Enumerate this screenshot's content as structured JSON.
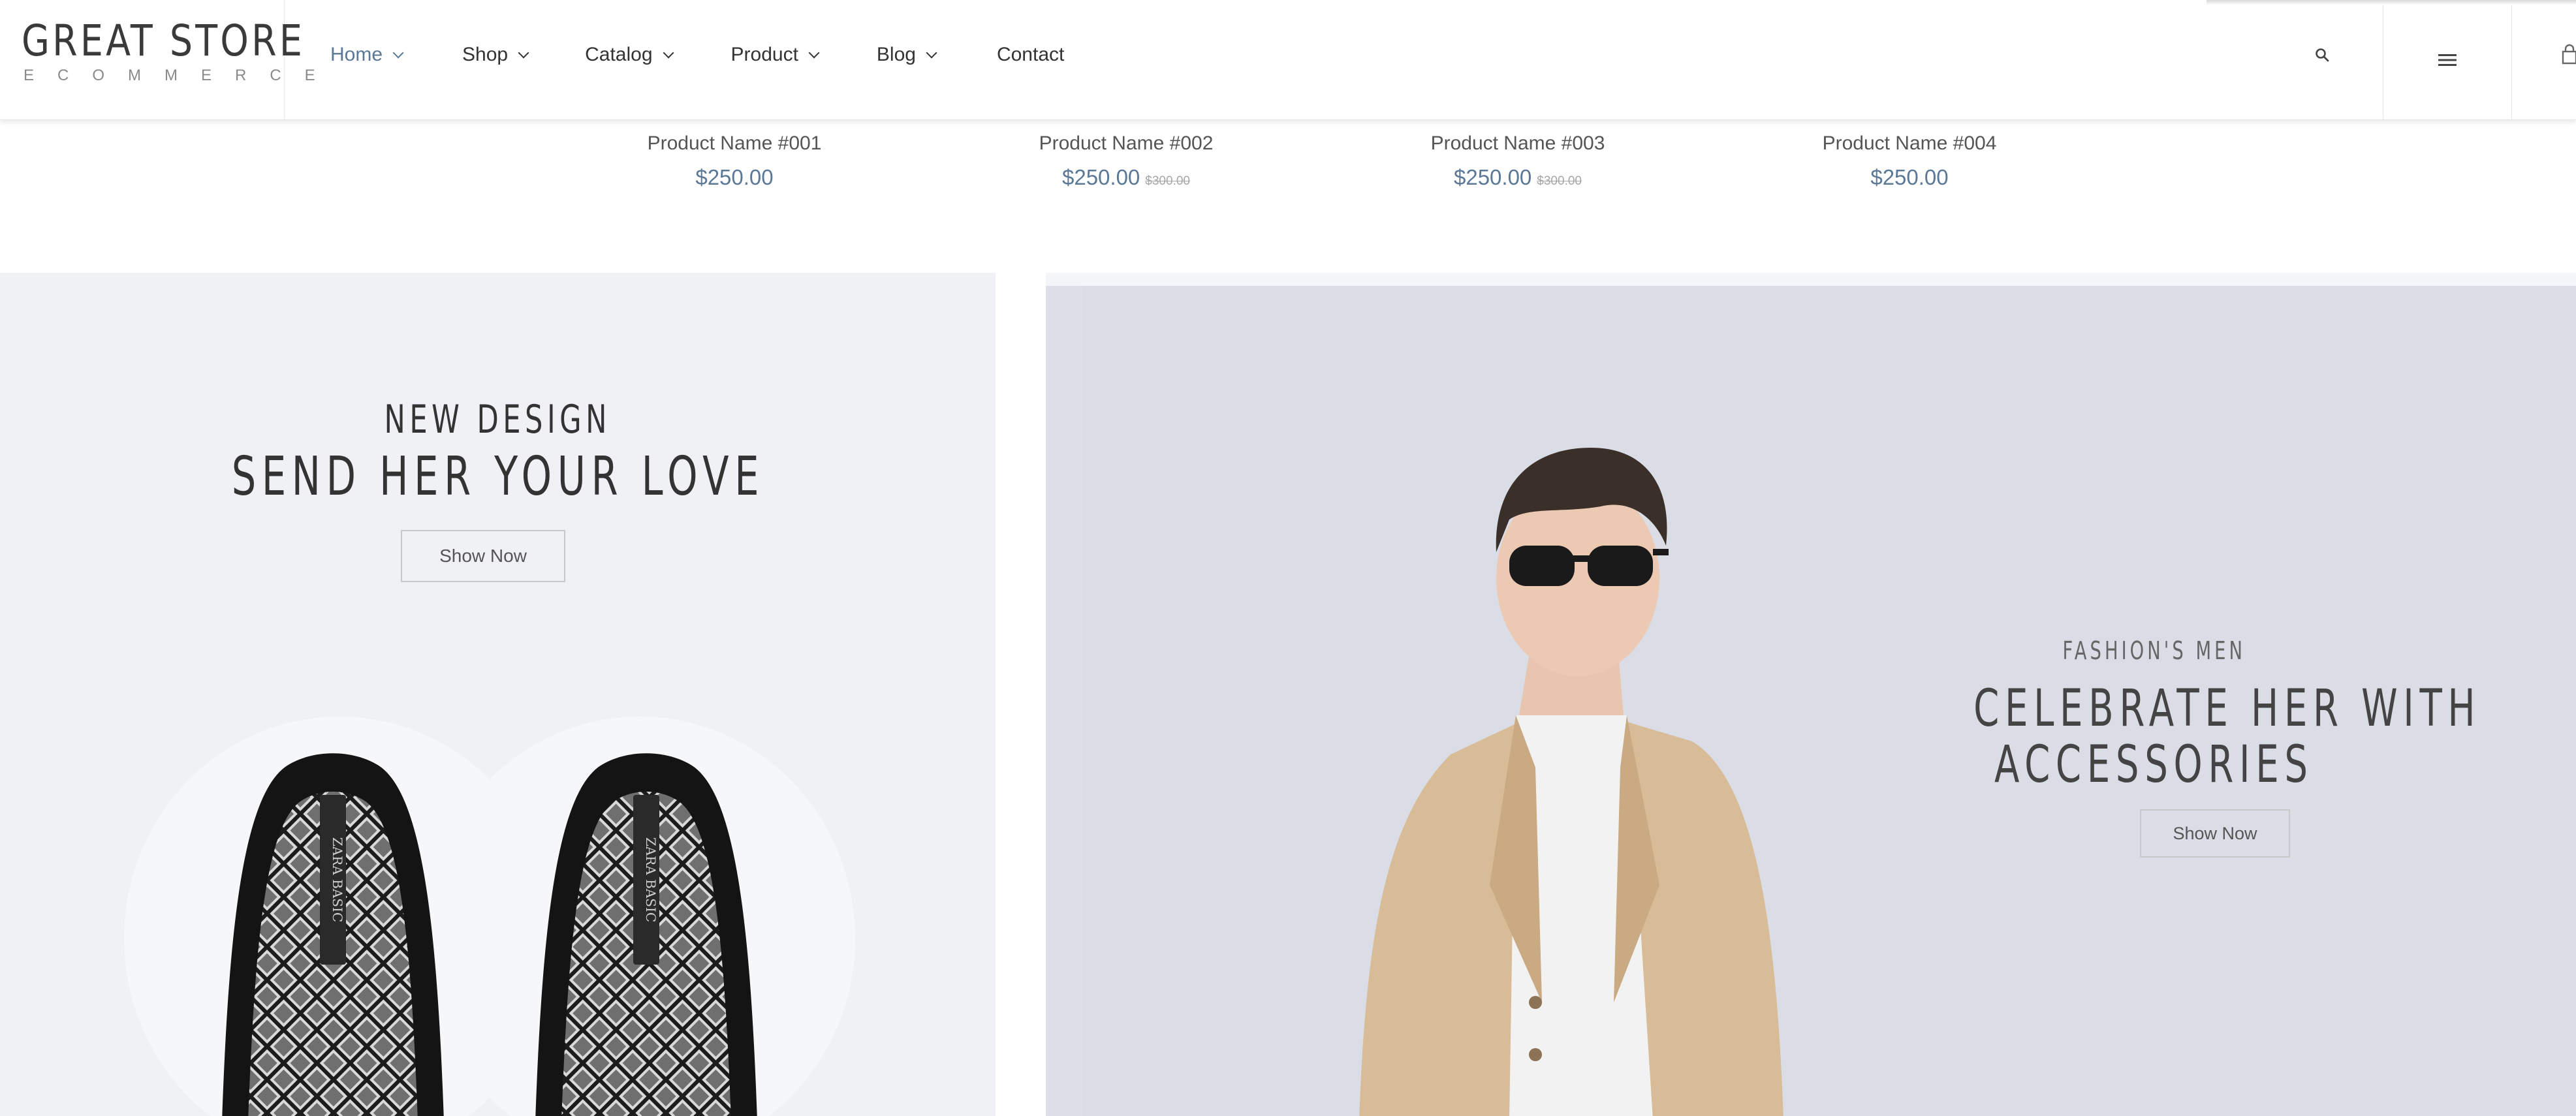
{
  "brand": {
    "title": "GREAT STORE",
    "subtitle": "ECOMMERCE"
  },
  "nav": {
    "items": [
      {
        "label": "Home",
        "dropdown": true,
        "active": true
      },
      {
        "label": "Shop",
        "dropdown": true
      },
      {
        "label": "Catalog",
        "dropdown": true
      },
      {
        "label": "Product",
        "dropdown": true
      },
      {
        "label": "Blog",
        "dropdown": true
      },
      {
        "label": "Contact",
        "dropdown": false
      }
    ],
    "icons": [
      "search-icon",
      "hamburger-menu-icon",
      "cart-icon"
    ]
  },
  "products": [
    {
      "name": "Product Name #001",
      "price": "$250.00",
      "old_price": ""
    },
    {
      "name": "Product Name #002",
      "price": "$250.00",
      "old_price": "$300.00"
    },
    {
      "name": "Product Name #003",
      "price": "$250.00",
      "old_price": "$300.00"
    },
    {
      "name": "Product Name #004",
      "price": "$250.00",
      "old_price": ""
    }
  ],
  "banner_left": {
    "subtitle": "NEW DESIGN",
    "title": "SEND HER YOUR LOVE",
    "button": "Show Now",
    "image": "black loafers with quilted insoles",
    "insole_text": "ZARA BASIC"
  },
  "banner_right": {
    "subtitle": "FASHION'S MEN",
    "title_line1": "CELEBRATE HER WITH",
    "title_line2": "ACCESSORIES",
    "button": "Show Now",
    "image": "man in beige blazer and sunglasses"
  },
  "colors": {
    "accent": "#5b7896",
    "text": "#333333",
    "banner_left_bg": "#f0f1f5",
    "banner_right_bg": "#dcdfe7",
    "blazer": "#d8bc98"
  }
}
